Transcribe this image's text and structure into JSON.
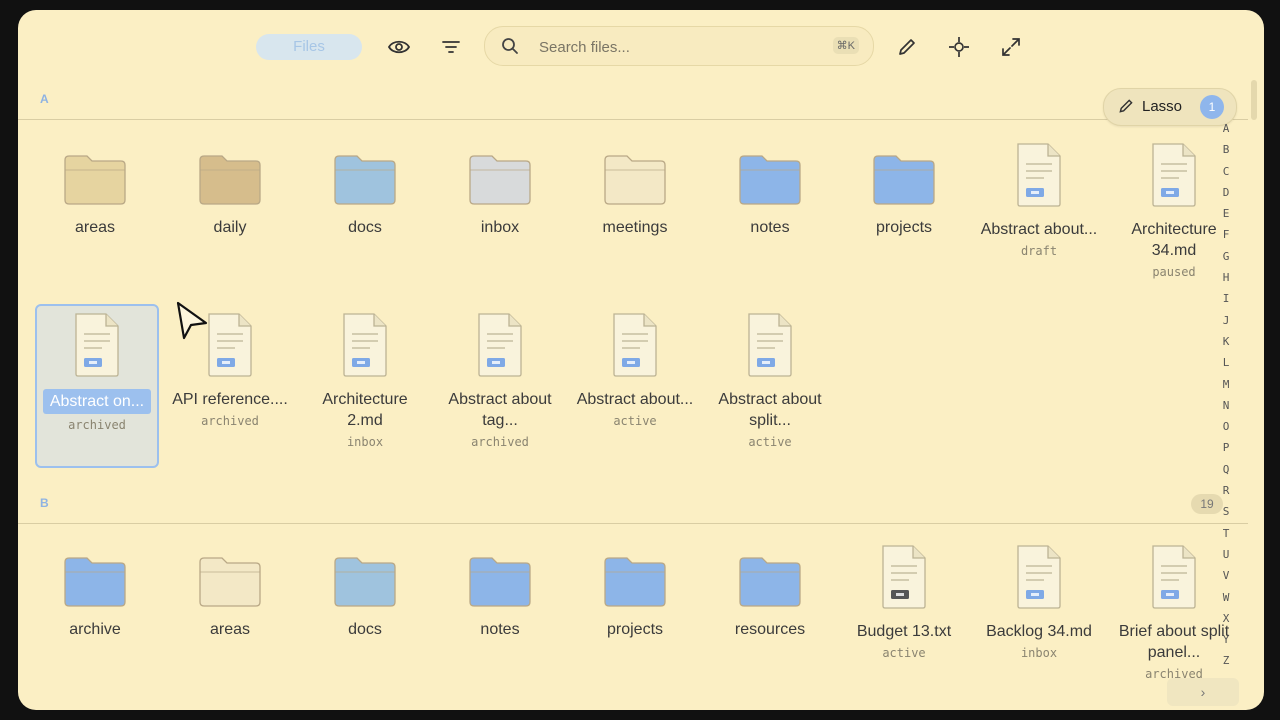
{
  "toolbar": {
    "files_label": "Files",
    "search_placeholder": "Search files...",
    "search_shortcut": "⌘K",
    "icons": [
      "eye-icon",
      "filter-icon",
      "search-icon",
      "pencil-icon",
      "crosshair-icon",
      "expand-icon"
    ]
  },
  "lasso": {
    "label": "Lasso",
    "count": "1"
  },
  "sections": [
    {
      "letter": "A",
      "items": [
        {
          "name": "areas",
          "kind": "folder",
          "color": "#e6d4a0"
        },
        {
          "name": "daily",
          "kind": "folder",
          "color": "#d6bd8c"
        },
        {
          "name": "docs",
          "kind": "folder",
          "color": "#9fc3de"
        },
        {
          "name": "inbox",
          "kind": "folder",
          "color": "#d8dadb"
        },
        {
          "name": "meetings",
          "kind": "folder",
          "color": "#f3e8c6"
        },
        {
          "name": "notes",
          "kind": "folder",
          "color": "#8db5e8"
        },
        {
          "name": "projects",
          "kind": "folder",
          "color": "#8db5e8"
        },
        {
          "name": "Abstract about...",
          "kind": "file",
          "status": "draft"
        },
        {
          "name": "Architecture 34.md",
          "kind": "file",
          "status": "paused"
        },
        {
          "name": "Abstract on...",
          "kind": "file",
          "status": "archived",
          "selected": true
        },
        {
          "name": "API reference....",
          "kind": "file",
          "status": "archived"
        },
        {
          "name": "Architecture 2.md",
          "kind": "file",
          "status": "inbox"
        },
        {
          "name": "Abstract about tag...",
          "kind": "file",
          "status": "archived"
        },
        {
          "name": "Abstract about...",
          "kind": "file",
          "status": "active"
        },
        {
          "name": "Abstract about split...",
          "kind": "file",
          "status": "active"
        }
      ]
    },
    {
      "letter": "B",
      "count": "19",
      "items": [
        {
          "name": "archive",
          "kind": "folder",
          "color": "#8db5e8"
        },
        {
          "name": "areas",
          "kind": "folder",
          "color": "#f3e8c6"
        },
        {
          "name": "docs",
          "kind": "folder",
          "color": "#9fc3de"
        },
        {
          "name": "notes",
          "kind": "folder",
          "color": "#8db5e8"
        },
        {
          "name": "projects",
          "kind": "folder",
          "color": "#8db5e8"
        },
        {
          "name": "resources",
          "kind": "folder",
          "color": "#8db5e8"
        },
        {
          "name": "Budget 13.txt",
          "kind": "file",
          "status": "active",
          "dark": true
        },
        {
          "name": "Backlog 34.md",
          "kind": "file",
          "status": "inbox"
        },
        {
          "name": "Brief about split panel...",
          "kind": "file",
          "status": "archived"
        }
      ]
    }
  ],
  "alphabet": [
    "A",
    "B",
    "C",
    "D",
    "E",
    "F",
    "G",
    "H",
    "I",
    "J",
    "K",
    "L",
    "M",
    "N",
    "O",
    "P",
    "Q",
    "R",
    "S",
    "T",
    "U",
    "V",
    "W",
    "X",
    "Y",
    "Z"
  ],
  "next_label": "›"
}
